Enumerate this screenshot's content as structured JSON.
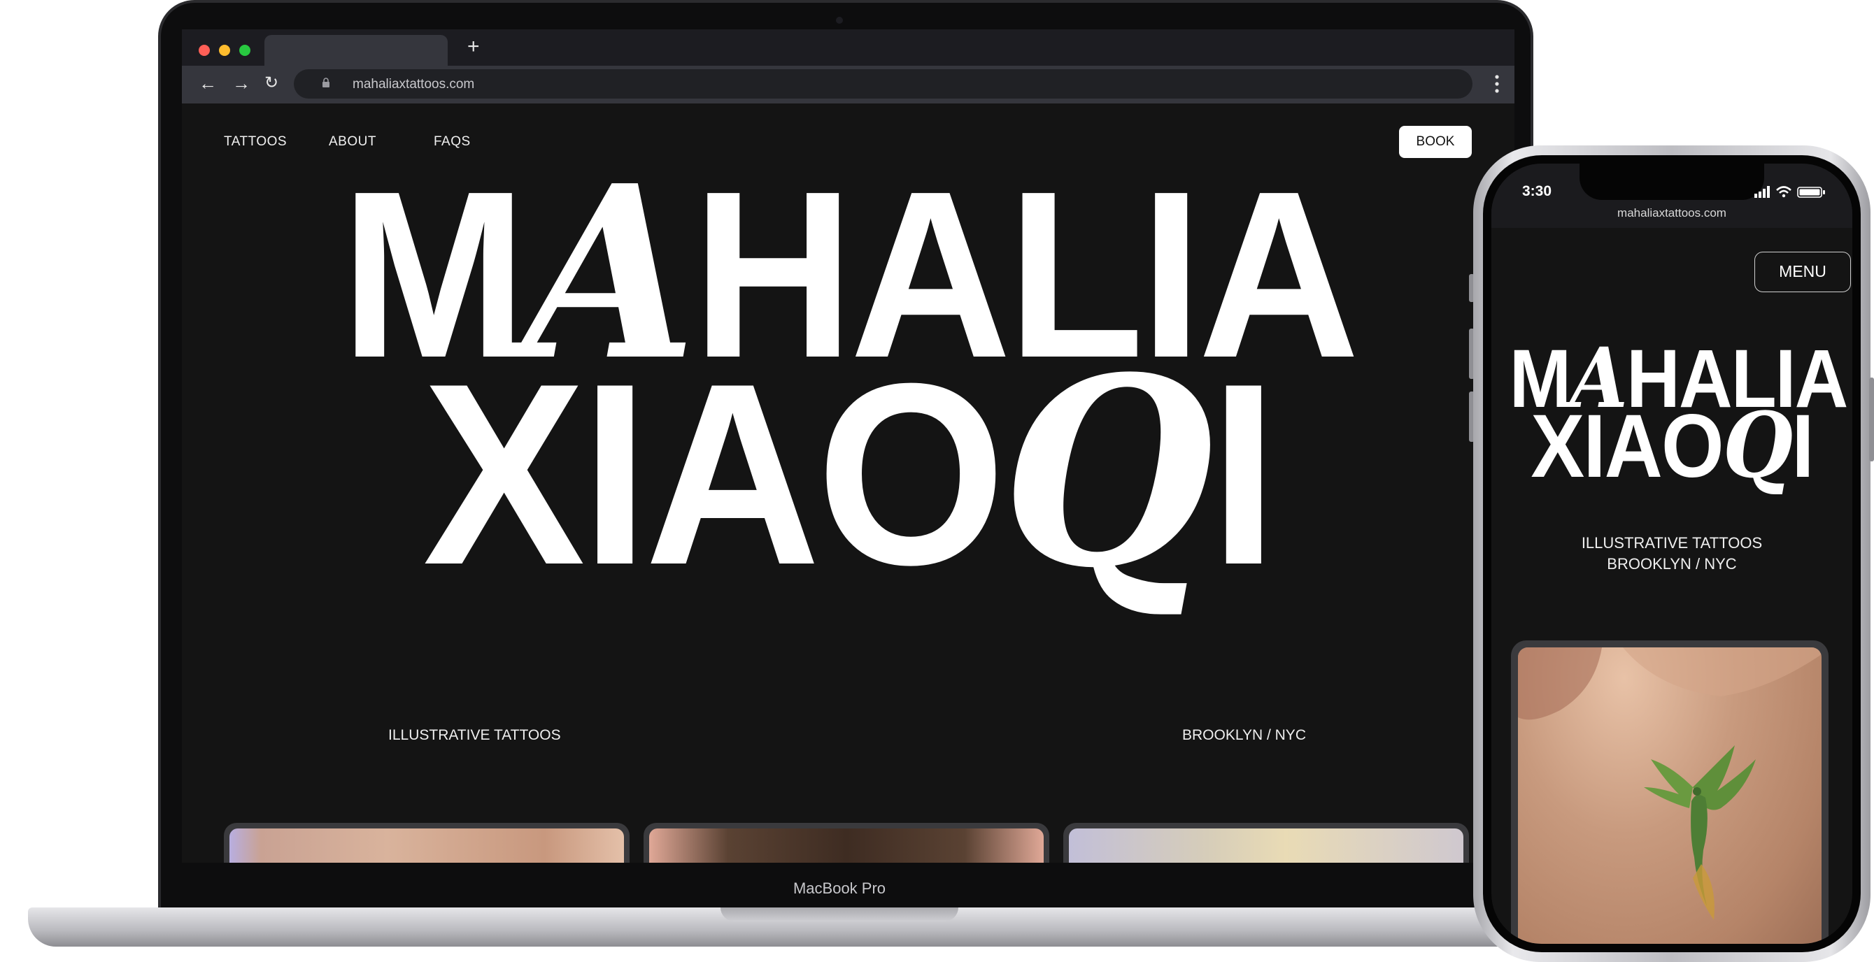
{
  "browser": {
    "url": "mahaliaxtattoos.com",
    "new_tab_symbol": "+",
    "back_symbol": "←",
    "forward_symbol": "→",
    "reload_symbol": "↻"
  },
  "site": {
    "nav": {
      "tattoos": "TATTOOS",
      "about": "ABOUT",
      "faqs": "FAQS",
      "book": "BOOK"
    },
    "hero": {
      "line1_a": "M",
      "line1_fancy": "A",
      "line1_b": "HALIA",
      "line2_a": "XIAO",
      "line2_fancy": "Q",
      "line2_b": "I"
    },
    "tagline_left": "ILLUSTRATIVE TATTOOS",
    "tagline_right": "BROOKLYN  / NYC"
  },
  "device": {
    "laptop_label": "MacBook Pro"
  },
  "phone": {
    "time": "3:30",
    "url": "mahaliaxtattoos.com",
    "menu": "MENU",
    "hero_line1_a": "M",
    "hero_line1_fancy": "A",
    "hero_line1_b": "HALIA",
    "hero_line2_a": "XIAO",
    "hero_line2_fancy": "Q",
    "hero_line2_b": "I",
    "tagline_1": "ILLUSTRATIVE TATTOOS",
    "tagline_2": "BROOKLYN  / NYC"
  },
  "colors": {
    "site_background": "#141414",
    "text": "#ffffff",
    "browser_chrome": "#35363d"
  }
}
